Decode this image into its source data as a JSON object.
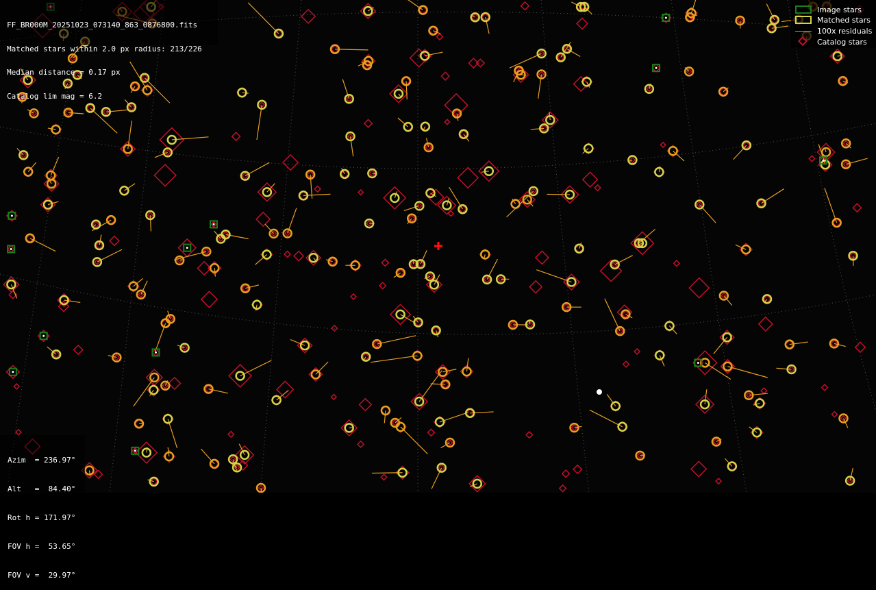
{
  "info": {
    "filename": "FF_BR000M_20251023_073140_863_0876800.fits",
    "matched": "Matched stars within 2.0 px radius: 213/226",
    "median": "Median distance = 0.17 px",
    "catalog": "Catalog lim mag = 6.2"
  },
  "legend": {
    "image_stars": "Image stars",
    "matched_stars": "Matched stars",
    "residuals": "100x residuals",
    "catalog_stars": "Catalog stars"
  },
  "pointing": {
    "azim": "Azim  = 236.97°",
    "alt": "Alt   =  84.40°",
    "rot": "Rot h = 171.97°",
    "fov_h": "FOV h =  53.65°",
    "fov_v": "FOV v =  29.97°"
  },
  "colors": {
    "background": "#050505",
    "image_star": "#1a7f1a",
    "matched_star": "#d4d44a",
    "residual": "#e8a020",
    "catalog_star": "#c0102a",
    "grid": "#555555"
  }
}
